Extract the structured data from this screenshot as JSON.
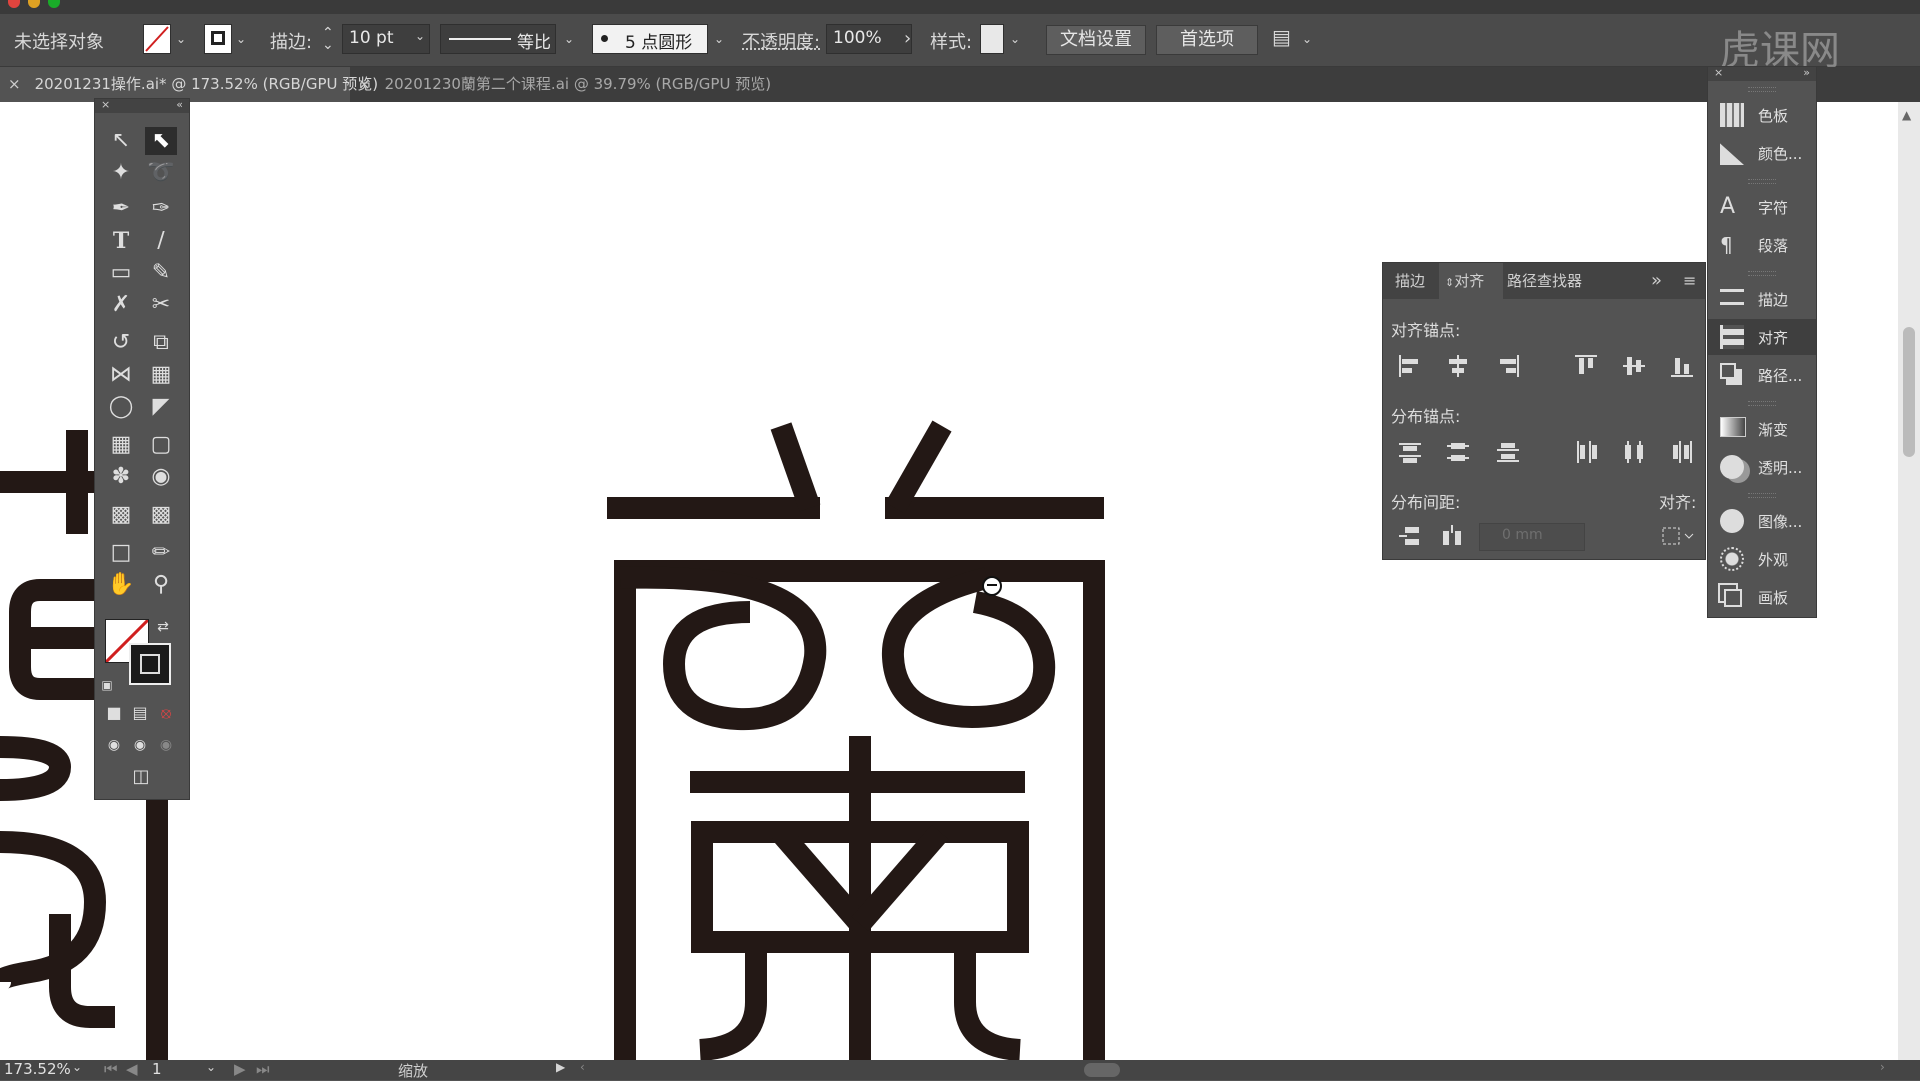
{
  "colors": {
    "stroke_glyph": "#231815",
    "ui_bg": "#535353",
    "canvas": "#ffffff"
  },
  "control_bar": {
    "selection_status": "未选择对象",
    "stroke_label": "描边:",
    "stroke_weight": "10 pt",
    "profile_label": "等比",
    "brush_label": "5 点圆形",
    "opacity_label": "不透明度:",
    "opacity_value": "100%",
    "style_label": "样式:",
    "doc_setup": "文档设置",
    "preferences": "首选项"
  },
  "watermark": "虎课网",
  "tabs": [
    {
      "label": "20201231操作.ai* @ 173.52% (RGB/GPU 预览)",
      "active": true
    },
    {
      "label": "20201230蘭第二个课程.ai @ 39.79% (RGB/GPU 预览)",
      "active": false
    }
  ],
  "align_panel": {
    "tabs": [
      "描边",
      "对齐",
      "路径查找器"
    ],
    "active_tab": "对齐",
    "align_objects_label": "对齐锚点:",
    "distribute_objects_label": "分布锚点:",
    "distribute_spacing_label": "分布间距:",
    "align_to_label": "对齐:",
    "spacing_value": "0 mm"
  },
  "dock": [
    {
      "label": "色板",
      "icon": "swatches-icon"
    },
    {
      "label": "颜色...",
      "icon": "color-icon"
    },
    {
      "label": "字符",
      "icon": "character-icon"
    },
    {
      "label": "段落",
      "icon": "paragraph-icon"
    },
    {
      "label": "描边",
      "icon": "stroke-icon"
    },
    {
      "label": "对齐",
      "icon": "align-icon"
    },
    {
      "label": "路径...",
      "icon": "pathfinder-icon"
    },
    {
      "label": "渐变",
      "icon": "gradient-icon"
    },
    {
      "label": "透明...",
      "icon": "transparency-icon"
    },
    {
      "label": "图像...",
      "icon": "image-trace-icon"
    },
    {
      "label": "外观",
      "icon": "appearance-icon"
    },
    {
      "label": "画板",
      "icon": "artboards-icon"
    }
  ],
  "status_bar": {
    "zoom": "173.52%",
    "artboard_number": "1",
    "tool_name": "缩放"
  }
}
